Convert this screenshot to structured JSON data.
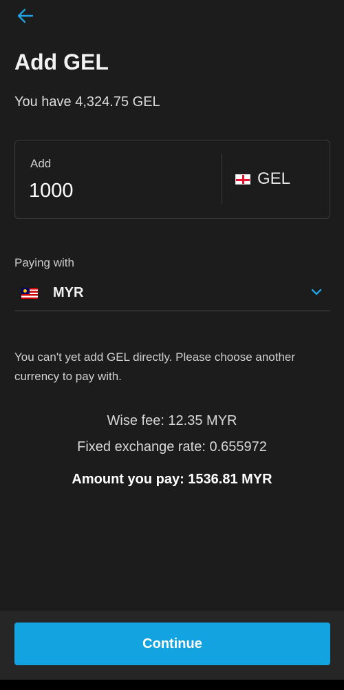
{
  "header": {
    "back_icon": "arrow-left-icon",
    "title": "Add GEL",
    "balance_text": "You have 4,324.75 GEL"
  },
  "amount": {
    "label": "Add",
    "value": "1000",
    "currency_flag": "georgia-flag-icon",
    "currency_code": "GEL"
  },
  "paying": {
    "label": "Paying with",
    "currency_flag": "malaysia-flag-icon",
    "currency_code": "MYR",
    "chevron_icon": "chevron-down-icon"
  },
  "info": {
    "message": "You can't yet add GEL directly. Please choose another currency to pay with.",
    "fee": "Wise fee: 12.35 MYR",
    "rate": "Fixed exchange rate: 0.655972",
    "total": "Amount you pay: 1536.81 MYR"
  },
  "actions": {
    "continue_label": "Continue"
  },
  "colors": {
    "background": "#1c1c1c",
    "accent": "#12a3e0",
    "footer": "#262626"
  }
}
